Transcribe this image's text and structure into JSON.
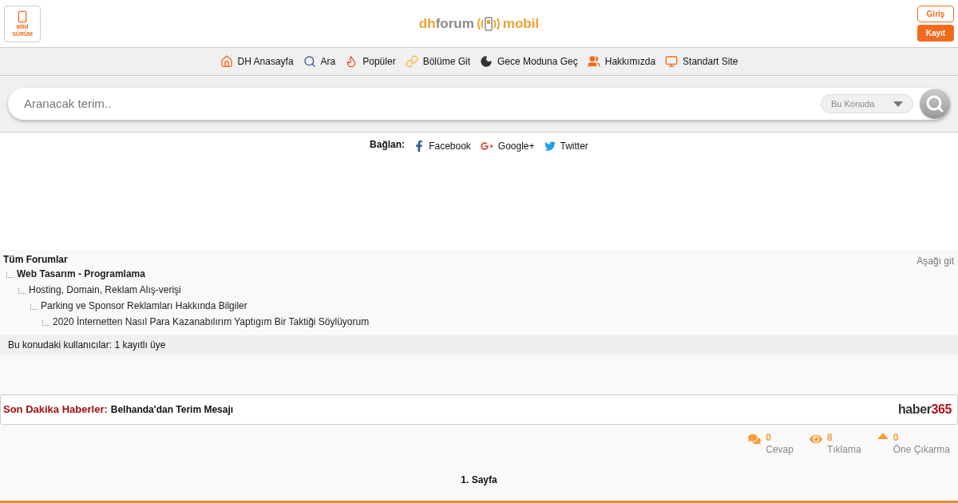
{
  "header": {
    "mini_version": [
      "MİNİ",
      "SÜRÜM"
    ],
    "logo": {
      "part_1": "dh",
      "part_2": "forum",
      "part_3": "mobil"
    },
    "buttons": [
      {
        "kind": "outline",
        "label": "Giriş"
      },
      {
        "kind": "filled",
        "label": "Kayıt"
      }
    ]
  },
  "nav": [
    {
      "kind": "home",
      "label": "DH Anasayfa"
    },
    {
      "kind": "search",
      "label": "Ara"
    },
    {
      "kind": "flame",
      "label": "Popüler"
    },
    {
      "kind": "link",
      "label": "Bölüme Git"
    },
    {
      "kind": "moon",
      "label": "Gece Moduna Geç"
    },
    {
      "kind": "users",
      "label": "Hakkımızda"
    },
    {
      "kind": "monitor",
      "label": "Standart Site"
    }
  ],
  "search": {
    "placeholder": "Aranacak terim..",
    "scope": "Bu Konuda"
  },
  "social": {
    "label": "Bağlan:",
    "links": [
      {
        "kind": "facebook",
        "label": "Facebook"
      },
      {
        "kind": "google",
        "label": "Google+"
      },
      {
        "kind": "twitter",
        "label": "Twitter"
      }
    ]
  },
  "breadcrumb": {
    "title": "Tüm Forumlar",
    "jump": "Aşağı git",
    "children": [
      {
        "label": "Web Tasarım - Programlama",
        "bold": true,
        "children": [
          {
            "label": "Hosting, Domain, Reklam Alış-verişi",
            "bold": false,
            "children": [
              {
                "label": "Parking ve Sponsor Reklamları Hakkında Bilgiler",
                "bold": false,
                "children": [
                  {
                    "label": "2020 İnternetten Nasıl Para Kazanabılırım Yaptıgım Bir Taktiği Söylüyorum",
                    "bold": false
                  }
                ]
              }
            ]
          }
        ]
      }
    ]
  },
  "users_bar": "Bu konudaki kullanıcılar: 1 kayıtlı üye",
  "news": {
    "label": "Son Dakika Haberler:",
    "headline": "Belhanda'dan Terim Mesajı",
    "logo": {
      "part_1": "haber",
      "part_2": "365"
    }
  },
  "stats": [
    {
      "kind": "replies",
      "value": "0",
      "label": "Cevap"
    },
    {
      "kind": "views",
      "value": "8",
      "label": "Tıklama"
    },
    {
      "kind": "promote",
      "value": "0",
      "label": "Öne Çıkarma"
    }
  ],
  "page": "1. Sayfa"
}
